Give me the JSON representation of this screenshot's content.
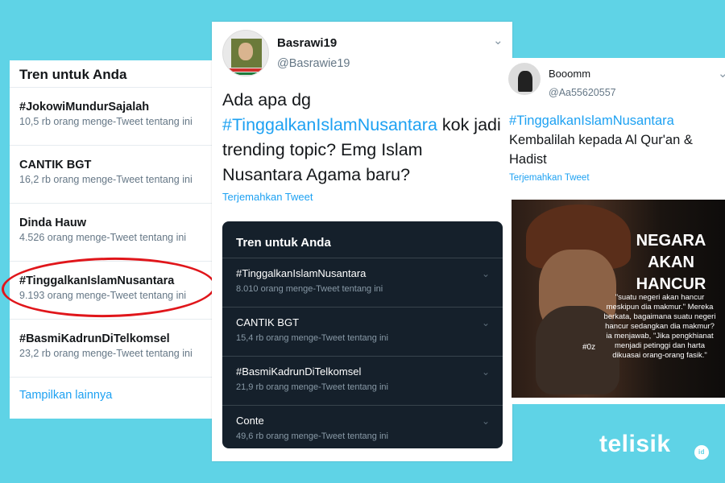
{
  "left_trends": {
    "title": "Tren untuk Anda",
    "items": [
      {
        "name": "#JokowiMundurSajalah",
        "count": "10,5 rb orang menge-Tweet tentang ini"
      },
      {
        "name": "CANTIK BGT",
        "count": "16,2 rb orang menge-Tweet tentang ini"
      },
      {
        "name": "Dinda Hauw",
        "count": "4.526 orang menge-Tweet tentang ini"
      },
      {
        "name": "#TinggalkanIslamNusantara",
        "count": "9.193 orang menge-Tweet tentang ini"
      },
      {
        "name": "#BasmiKadrunDiTelkomsel",
        "count": "23,2 rb orang menge-Tweet tentang ini"
      }
    ],
    "show_more": "Tampilkan lainnya"
  },
  "mid_tweet": {
    "display_name": "Basrawi19",
    "handle": "@Basrawie19",
    "text_before": "Ada apa dg ",
    "hashtag": "#TinggalkanIslamNusantara",
    "text_after": " kok jadi trending topic? Emg Islam Nusantara Agama baru?",
    "translate": "Terjemahkan Tweet",
    "chevron": "chevron-down-icon"
  },
  "dark_trends": {
    "title": "Tren untuk Anda",
    "items": [
      {
        "name": "#TinggalkanIslamNusantara",
        "count": "8.010 orang menge-Tweet tentang ini"
      },
      {
        "name": "CANTIK BGT",
        "count": "15,4 rb orang menge-Tweet tentang ini"
      },
      {
        "name": "#BasmiKadrunDiTelkomsel",
        "count": "21,9 rb orang menge-Tweet tentang ini"
      },
      {
        "name": "Conte",
        "count": "49,6 rb orang menge-Tweet tentang ini"
      }
    ]
  },
  "right_tweet": {
    "display_name": "Booomm",
    "handle": "@Aa55620557",
    "hashtag": "#TinggalkanIslamNusantara",
    "text": "Kembalilah kepada Al Qur'an & Hadist",
    "translate": "Terjemahkan Tweet",
    "image": {
      "headline": "NEGARA AKAN HANCUR",
      "quote": "\"suatu negeri akan hancur meskipun dia makmur.\" Mereka berkata, bagaimana suatu negeri hancur sedangkan dia makmur? ia menjawab, \"Jika pengkhianat menjadi petinggi dan harta dikuasai orang-orang fasik.\"",
      "mark": "#0z"
    }
  },
  "logo": {
    "text": "telisik",
    "suffix": "id"
  },
  "colors": {
    "background": "#5fd3e6",
    "link": "#1da1f2",
    "dark_card": "#15202b",
    "highlight": "#e0161b"
  }
}
